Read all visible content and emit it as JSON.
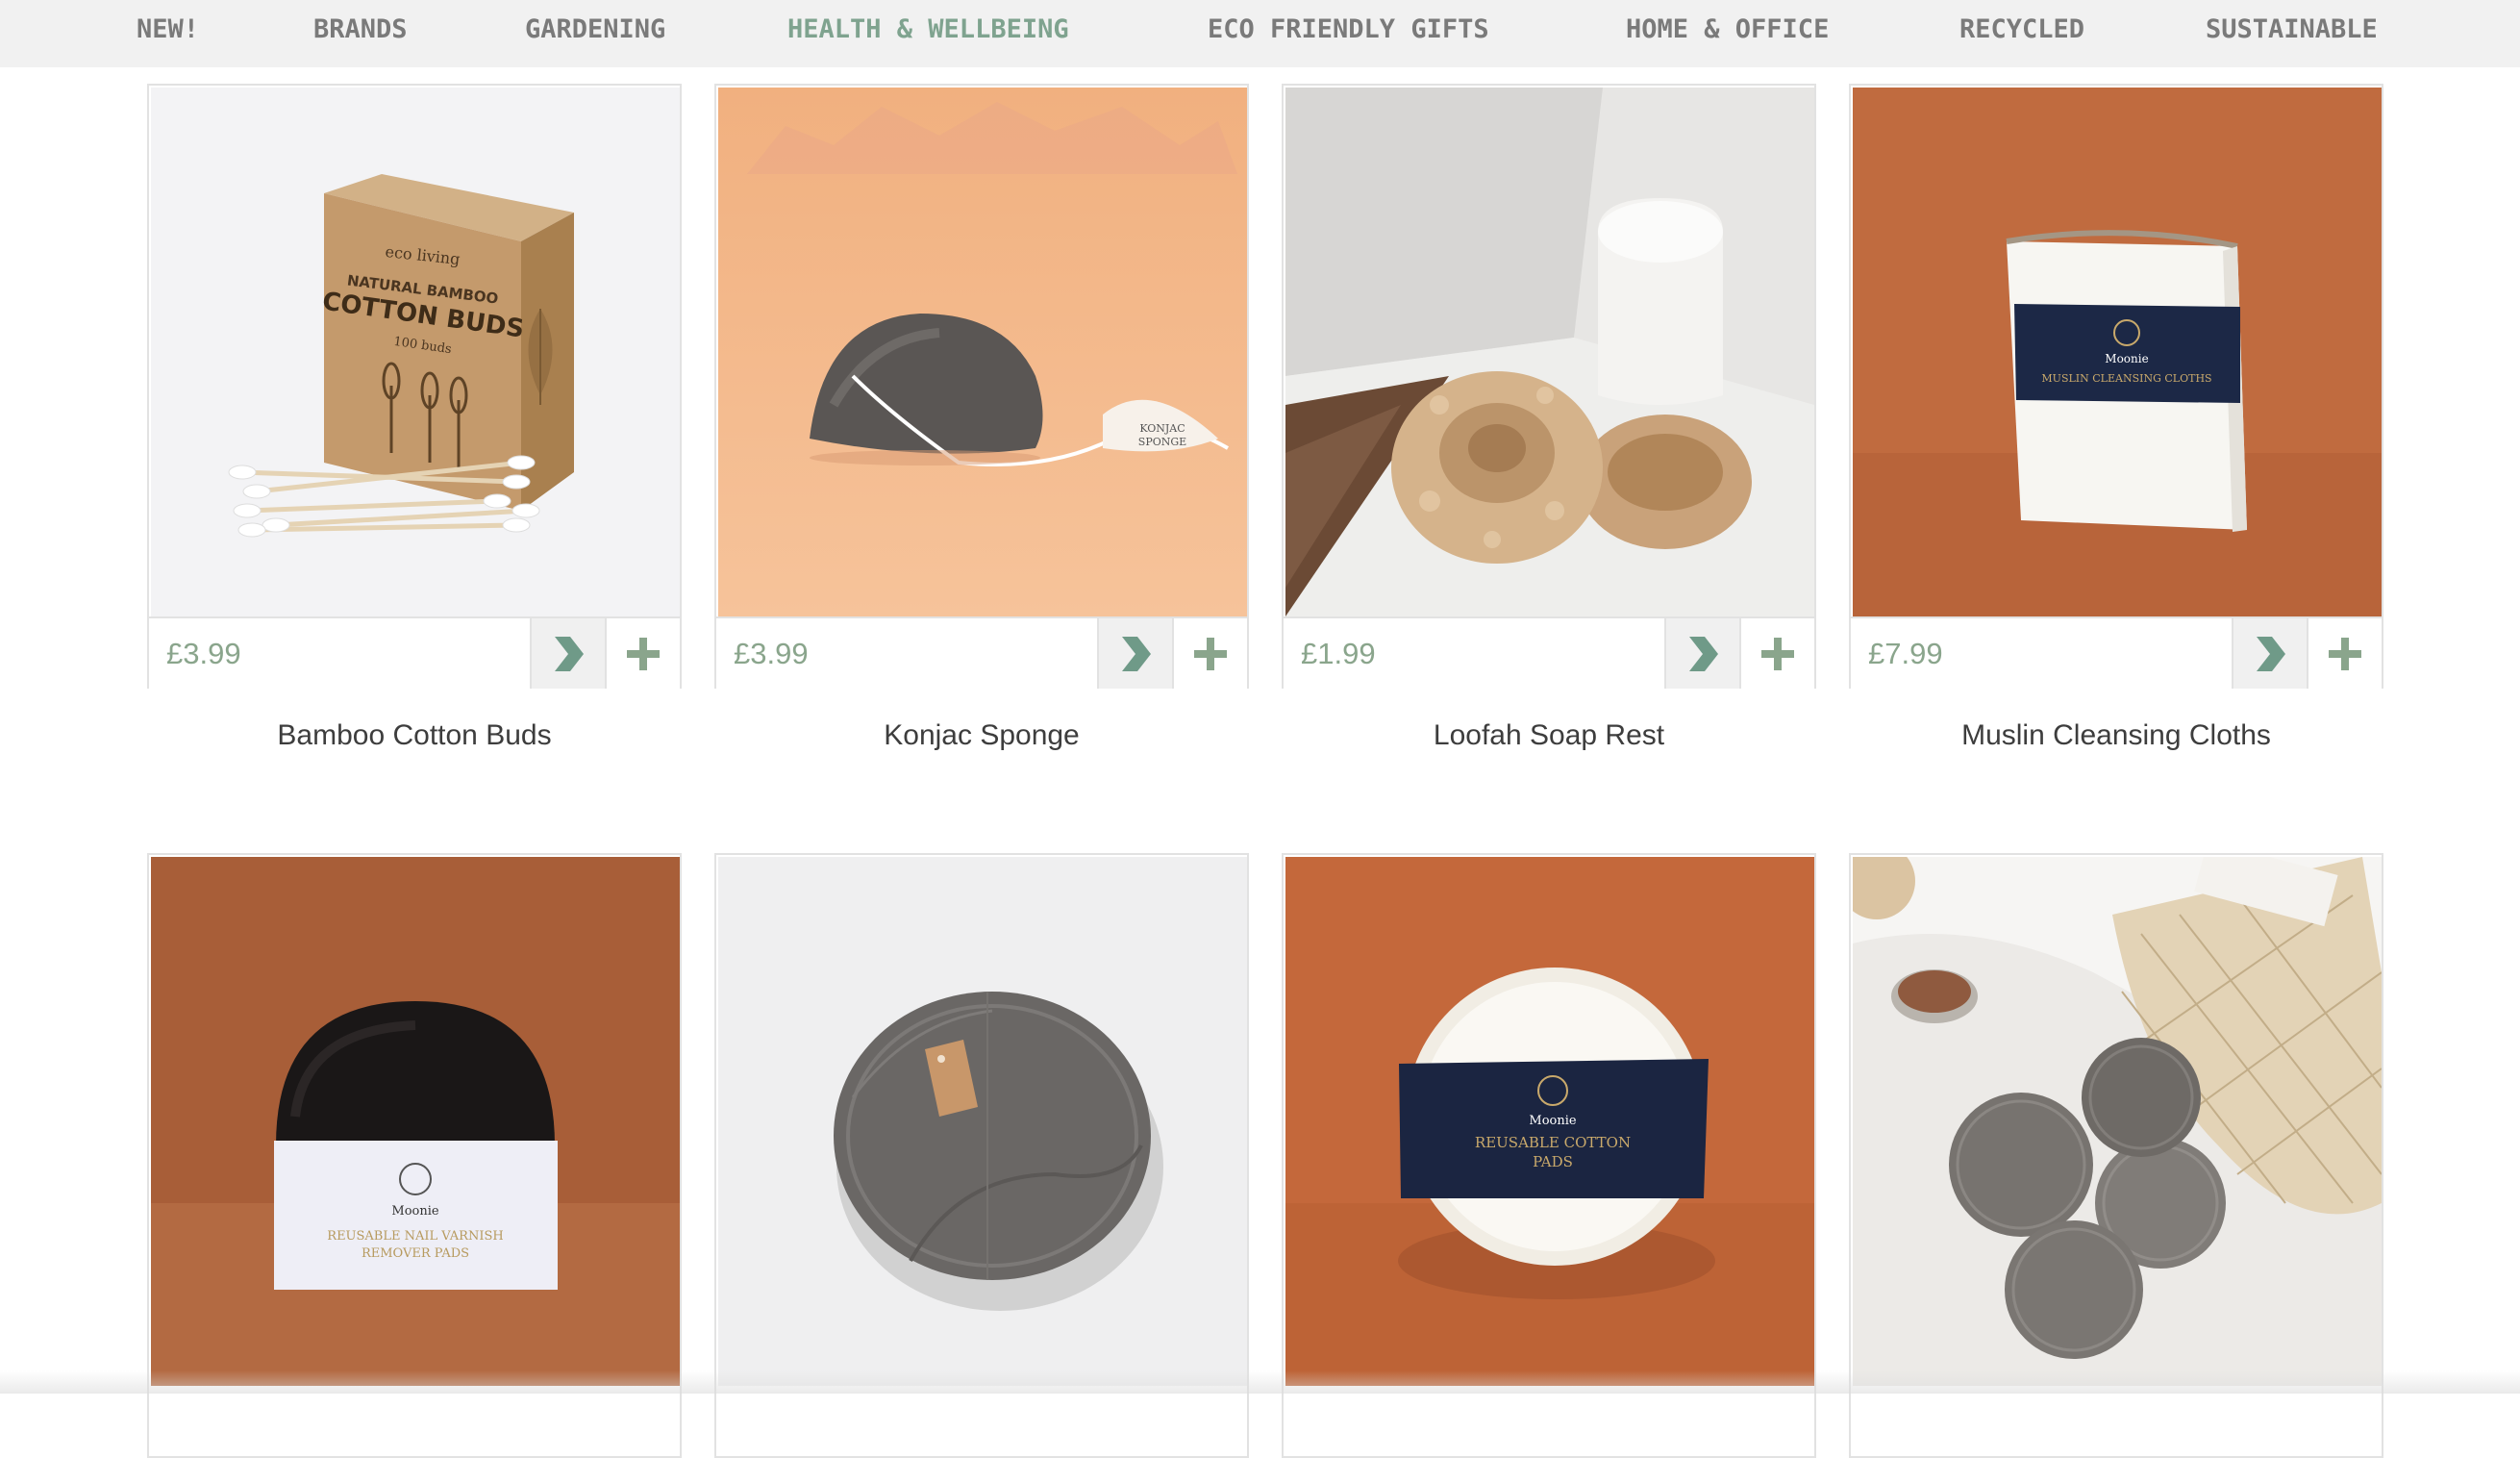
{
  "nav": {
    "items": [
      "NEW!",
      "BRANDS",
      "GARDENING",
      "HEALTH & WELLBEING",
      "ECO FRIENDLY GIFTS",
      "HOME & OFFICE",
      "RECYCLED",
      "SUSTAINABLE"
    ],
    "active": "HEALTH & WELLBEING"
  },
  "products": [
    {
      "name": "Bamboo Cotton Buds",
      "price": "£3.99",
      "image_text": {
        "brand": "eco living",
        "line1": "NATURAL BAMBOO",
        "line2": "COTTON BUDS",
        "line3": "100 buds"
      }
    },
    {
      "name": "Konjac Sponge",
      "price": "£3.99",
      "image_text": {
        "tag_line1": "KONJAC",
        "tag_line2": "SPONGE"
      }
    },
    {
      "name": "Loofah Soap Rest",
      "price": "£1.99"
    },
    {
      "name": "Muslin Cleansing Cloths",
      "price": "£7.99",
      "image_text": {
        "brand": "Moonie",
        "title": "MUSLIN CLEANSING CLOTHS"
      }
    },
    {
      "image_text": {
        "brand": "Moonie",
        "title_line1": "REUSABLE NAIL VARNISH",
        "title_line2": "REMOVER PADS"
      }
    },
    {},
    {
      "image_text": {
        "brand": "Moonie",
        "title_line1": "REUSABLE COTTON",
        "title_line2": "PADS"
      }
    },
    {}
  ],
  "icons": {
    "view": "chevron-right-icon",
    "add": "plus-icon"
  },
  "colors": {
    "accent": "#7fa38f",
    "price": "#8aa58c",
    "nav_text": "#7a7a7a",
    "nav_bg": "#f1f1f1"
  }
}
